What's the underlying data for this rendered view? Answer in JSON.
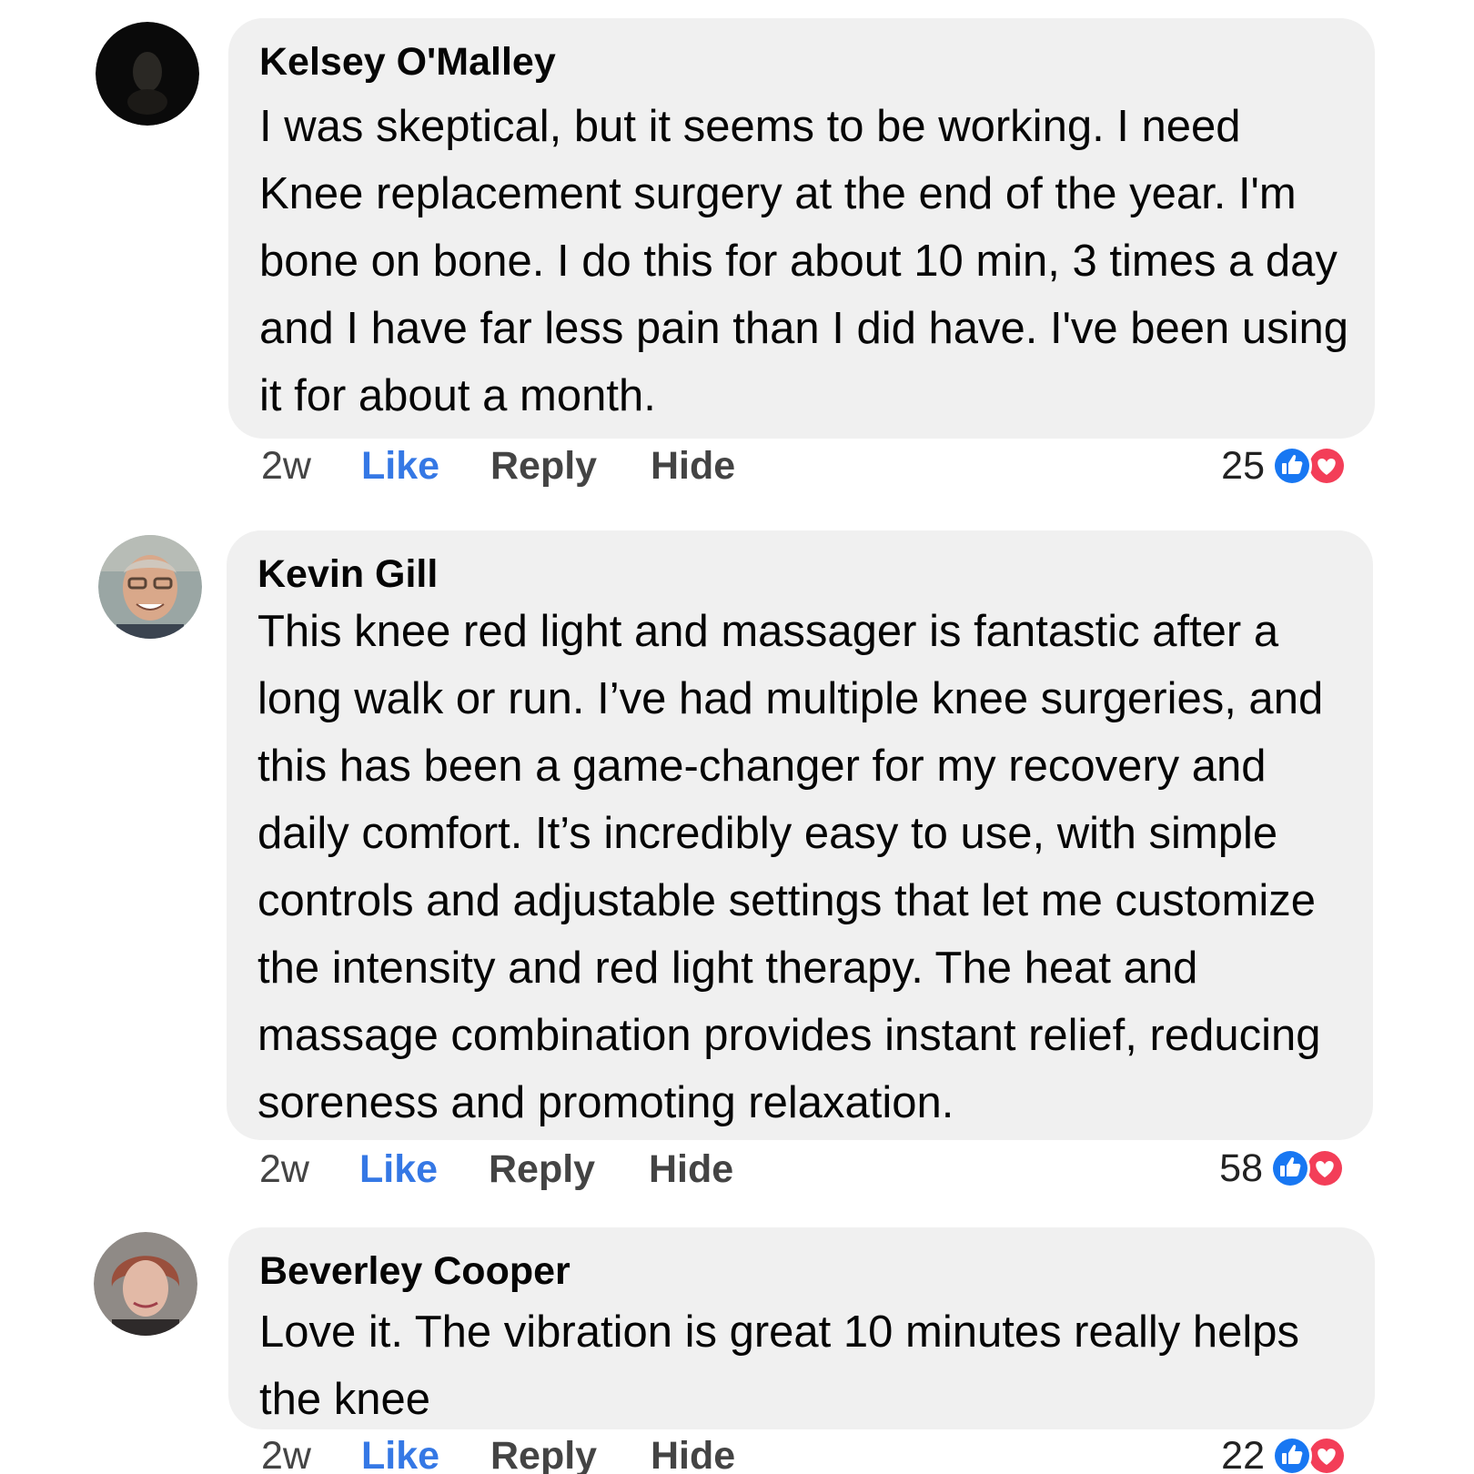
{
  "comments": [
    {
      "author": "Kelsey O'Malley",
      "text": "I was skeptical, but it seems to be working. I need Knee replacement surgery at the end of the year. I'm bone on bone. I do this for about 10 min, 3 times a day and I have far less pain than I did have. I've been using it for about a month.",
      "time": "2w",
      "like_label": "Like",
      "reply_label": "Reply",
      "hide_label": "Hide",
      "reaction_count": "25",
      "reactions": [
        "like-icon",
        "love-icon"
      ]
    },
    {
      "author": "Kevin Gill",
      "text": "This knee red light and massager is fantastic after a long walk or run. I’ve had multiple knee surgeries, and this has been a game-changer for my recovery and daily comfort. It’s incredibly easy to use, with simple controls and adjustable settings that let me customize the intensity and red light therapy. The heat and massage combination provides instant relief, reducing soreness and promoting relaxation.",
      "time": "2w",
      "like_label": "Like",
      "reply_label": "Reply",
      "hide_label": "Hide",
      "reaction_count": "58",
      "reactions": [
        "like-icon",
        "love-icon"
      ]
    },
    {
      "author": "Beverley Cooper",
      "text": "Love it. The vibration is great 10 minutes really helps the knee",
      "time": "2w",
      "like_label": "Like",
      "reply_label": "Reply",
      "hide_label": "Hide",
      "reaction_count": "22",
      "reactions": [
        "like-icon",
        "love-icon"
      ]
    }
  ],
  "colors": {
    "bubble": "#f0f0f0",
    "like_text": "#3578e5",
    "like_reaction": "#1877f2",
    "love_reaction": "#f33e58"
  }
}
